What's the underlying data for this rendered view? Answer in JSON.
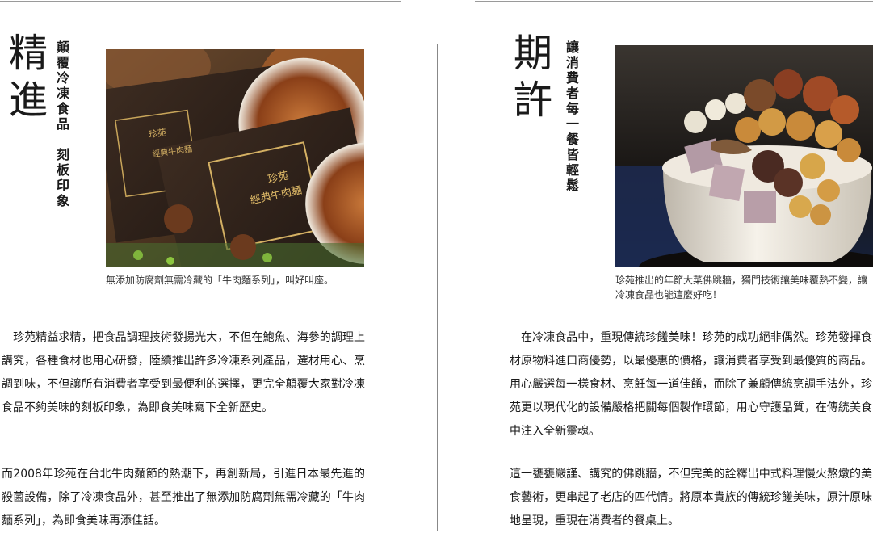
{
  "left": {
    "heading": "精進",
    "subheading": "顛覆冷凍食品　刻板印象",
    "caption": "無添加防腐劑無需冷藏的「牛肉麵系列」，叫好叫座。",
    "paragraphs": [
      "　珍苑精益求精，把食品調理技術發揚光大，不但在鮑魚、海參的調理上講究，各種食材也用心研發，陸續推出許多冷凍系列產品，選材用心、烹調到味，不但讓所有消費者享受到最便利的選擇，更完全顛覆大家對冷凍食品不夠美味的刻板印象，為即食美味寫下全新歷史。",
      "而2008年珍苑在台北牛肉麵節的熱潮下，再創新局，引進日本最先進的殺菌設備，除了冷凍食品外，甚至推出了無添加防腐劑無需冷藏的「牛肉麵系列」，為即食美味再添佳話。"
    ],
    "photo_box": {
      "brand": "珍苑",
      "product": "經典牛肉麵"
    }
  },
  "right": {
    "heading": "期許",
    "subheading": "讓消費者每一餐皆輕鬆",
    "caption": "珍苑推出的年節大菜佛跳牆，獨門技術讓美味覆熱不變，讓冷凍食品也能這麼好吃！",
    "paragraphs": [
      "　在冷凍食品中，重現傳統珍饈美味！珍苑的成功絕非偶然。珍苑發揮食材原物料進口商優勢，以最優惠的價格，讓消費者享受到最優質的商品。用心嚴選每一樣食材、烹飪每一道佳餚，而除了兼顧傳統烹調手法外，珍苑更以現代化的設備嚴格把關每個製作環節，用心守護品質，在傳統美食中注入全新靈魂。",
      "這一甕甕嚴謹、講究的佛跳牆，不但完美的詮釋出中式料理慢火熬燉的美食藝術，更串起了老店的四代情。將原本貴族的傳統珍饈美味，原汁原味地呈現，重現在消費者的餐桌上。"
    ]
  }
}
